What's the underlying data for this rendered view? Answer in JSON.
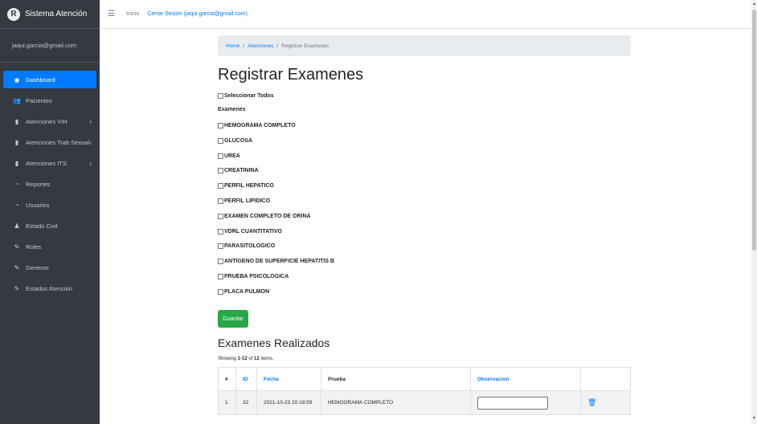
{
  "brand": {
    "logo_letter": "R",
    "title": "Sistema Atención"
  },
  "user": {
    "email": "jaqui.garcia@gmail.com"
  },
  "sidebar": {
    "items": [
      {
        "label": "Dashboard",
        "icon": "tachometer-icon",
        "glyph": "◉",
        "active": true,
        "arrow": ""
      },
      {
        "label": "Pacientes",
        "icon": "users-icon",
        "glyph": "👥",
        "active": false,
        "arrow": ""
      },
      {
        "label": "Atenciones VIH",
        "icon": "file-icon",
        "glyph": "▮",
        "active": false,
        "arrow": "‹"
      },
      {
        "label": "Atenciones Trab Sexual",
        "icon": "file-icon",
        "glyph": "▮",
        "active": false,
        "arrow": "‹"
      },
      {
        "label": "Atenciones ITS",
        "icon": "file-icon",
        "glyph": "▮",
        "active": false,
        "arrow": "‹"
      },
      {
        "label": "Reportes",
        "icon": "chart-pie-icon",
        "glyph": "◔",
        "active": false,
        "arrow": ""
      },
      {
        "label": "Usuarios",
        "icon": "chart-pie-icon",
        "glyph": "◔",
        "active": false,
        "arrow": ""
      },
      {
        "label": "Estado Civil",
        "icon": "person-icon",
        "glyph": "♟",
        "active": false,
        "arrow": ""
      },
      {
        "label": "Roles",
        "icon": "edit-icon",
        "glyph": "✎",
        "active": false,
        "arrow": ""
      },
      {
        "label": "Generos",
        "icon": "edit-icon",
        "glyph": "✎",
        "active": false,
        "arrow": ""
      },
      {
        "label": "Estados Atención",
        "icon": "edit-icon",
        "glyph": "✎",
        "active": false,
        "arrow": ""
      }
    ]
  },
  "topbar": {
    "menu_icon": "☰",
    "home_label": "Inicio",
    "logout_label": "Cerrar Sesión (jaqui.garcia@gmail.com)"
  },
  "breadcrumb": {
    "home": "Home",
    "sep": "/",
    "section": "Atenciones",
    "current": "Registrar Examenes"
  },
  "page": {
    "title": "Registrar Examenes",
    "select_all_label": "Seleccionar Todos",
    "exams_label": "Examenes",
    "exams": [
      "HEMOGRAMA COMPLETO",
      "GLUCOSA",
      "UREA",
      "CREATININA",
      "PERFIL HEPATICO",
      "PERFIL LIPIDICO",
      "EXAMEN COMPLETO DE ORINA",
      "VDRL CUANTITATIVO",
      "PARASITOLOGICO",
      "ANTIGENO DE SUPERFICIE HEPATITIS B",
      "PRUEBA PSICOLOGICA",
      "PLACA PULMON"
    ],
    "save_label": "Guardar"
  },
  "results": {
    "title": "Examenes Realizados",
    "summary_prefix": "Showing ",
    "summary_range": "1-12",
    "summary_of": " of ",
    "summary_total": "12",
    "summary_suffix": " items.",
    "headers": [
      "#",
      "ID",
      "Fecha",
      "Prueba",
      "Observacion",
      ""
    ],
    "rows": [
      {
        "num": "1",
        "id": "32",
        "fecha": "2021-10-23 20:18:59",
        "prueba": "HEMOGRAMA COMPLETO",
        "observacion": ""
      }
    ]
  },
  "colors": {
    "primary": "#007bff",
    "success": "#28a745",
    "sidebar_bg": "#343a40"
  }
}
